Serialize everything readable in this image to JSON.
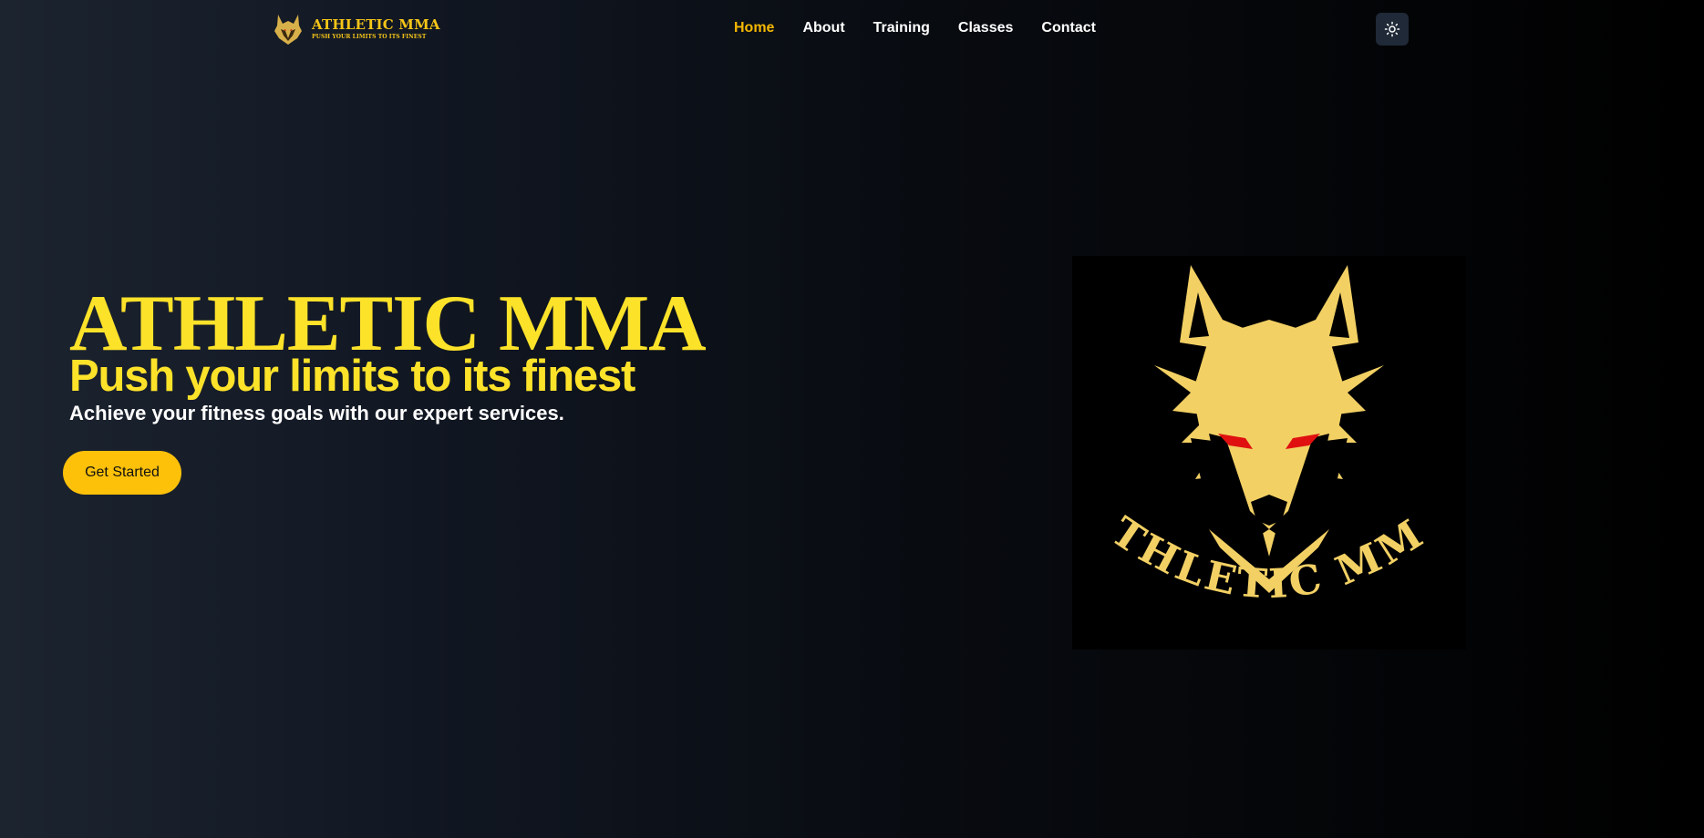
{
  "brand": {
    "title": "ATHLETIC MMA",
    "subtitle": "PUSH YOUR LIMITS TO ITS FINEST",
    "logo_icon": "wolf-head-icon"
  },
  "nav": {
    "items": [
      {
        "label": "Home",
        "active": true
      },
      {
        "label": "About",
        "active": false
      },
      {
        "label": "Training",
        "active": false
      },
      {
        "label": "Classes",
        "active": false
      },
      {
        "label": "Contact",
        "active": false
      }
    ],
    "theme_toggle_icon": "sun-icon"
  },
  "hero": {
    "title": "ATHLETIC MMA",
    "tagline": "Push your limits to its finest",
    "description": "Achieve your fitness goals with our expert services.",
    "cta_label": "Get Started",
    "emblem_text": "ATHLETIC MMA",
    "emblem_icon": "wolf-emblem-icon"
  },
  "colors": {
    "accent_yellow": "#fde22a",
    "active_nav": "#f5b800",
    "button_bg": "#fdc10a",
    "logo_gold": "#f2d064",
    "eye_red": "#e01010",
    "toggle_bg": "#1f2937"
  }
}
